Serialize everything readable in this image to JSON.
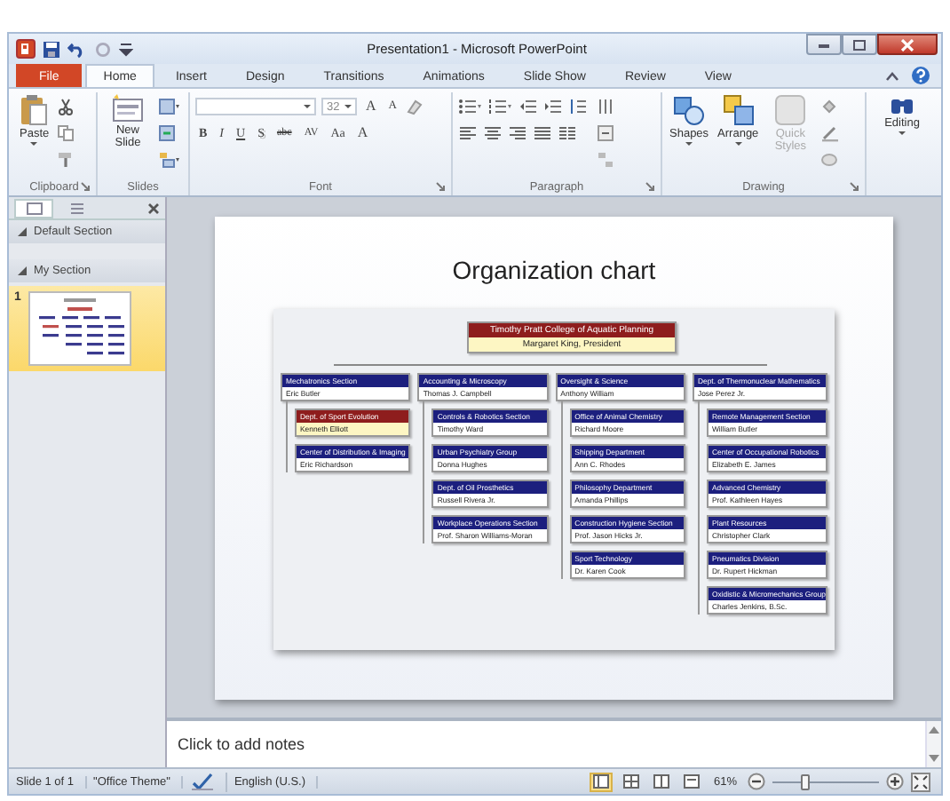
{
  "window": {
    "title": "Presentation1 - Microsoft PowerPoint"
  },
  "tabs": [
    {
      "label": "File",
      "kind": "file",
      "selected": false
    },
    {
      "label": "Home",
      "kind": "tab",
      "selected": true
    },
    {
      "label": "Insert",
      "kind": "tab",
      "selected": false
    },
    {
      "label": "Design",
      "kind": "tab",
      "selected": false
    },
    {
      "label": "Transitions",
      "kind": "tab",
      "selected": false
    },
    {
      "label": "Animations",
      "kind": "tab",
      "selected": false
    },
    {
      "label": "Slide Show",
      "kind": "tab",
      "selected": false
    },
    {
      "label": "Review",
      "kind": "tab",
      "selected": false
    },
    {
      "label": "View",
      "kind": "tab",
      "selected": false
    }
  ],
  "ribbon": {
    "clipboard": {
      "label": "Clipboard",
      "paste": "Paste"
    },
    "slides": {
      "label": "Slides",
      "new_slide": "New Slide"
    },
    "font": {
      "label": "Font",
      "size": "32",
      "grow": "A",
      "shrink": "A",
      "format_buttons": [
        "B",
        "I",
        "U",
        "S",
        "abc",
        "AV",
        "Aa"
      ],
      "color_button": "A"
    },
    "paragraph": {
      "label": "Paragraph"
    },
    "drawing": {
      "label": "Drawing",
      "shapes": "Shapes",
      "arrange": "Arrange",
      "quick_styles": {
        "label": "Quick Styles",
        "disabled": true
      }
    },
    "editing": {
      "label": "Editing"
    }
  },
  "slides_pane": {
    "sections": [
      {
        "label": "Default Section"
      },
      {
        "label": "My Section"
      }
    ],
    "slides": [
      {
        "number": "1",
        "selected": true
      }
    ]
  },
  "slide": {
    "title": "Organization chart",
    "chart": {
      "root": {
        "title": "Timothy Pratt College of Aquatic Planning",
        "name": "Margaret King, President",
        "kind": "accent"
      },
      "columns": [
        {
          "title": "Mechatronics Section",
          "name": "Eric Butler",
          "kind": "standard",
          "children": [
            {
              "title": "Dept. of Sport Evolution",
              "name": "Kenneth Elliott",
              "kind": "accent"
            },
            {
              "title": "Center of Distribution & Imaging",
              "name": "Eric Richardson",
              "kind": "standard"
            }
          ]
        },
        {
          "title": "Accounting & Microscopy",
          "name": "Thomas J. Campbell",
          "kind": "standard",
          "children": [
            {
              "title": "Controls & Robotics Section",
              "name": "Timothy Ward",
              "kind": "standard"
            },
            {
              "title": "Urban Psychiatry Group",
              "name": "Donna Hughes",
              "kind": "standard"
            },
            {
              "title": "Dept. of Oil Prosthetics",
              "name": "Russell Rivera Jr.",
              "kind": "standard"
            },
            {
              "title": "Workplace Operations Section",
              "name": "Prof. Sharon Williams-Moran",
              "kind": "standard"
            }
          ]
        },
        {
          "title": "Oversight & Science",
          "name": "Anthony William",
          "kind": "standard",
          "children": [
            {
              "title": "Office of Animal Chemistry",
              "name": "Richard Moore",
              "kind": "standard"
            },
            {
              "title": "Shipping Department",
              "name": "Ann C. Rhodes",
              "kind": "standard"
            },
            {
              "title": "Philosophy Department",
              "name": "Amanda Phillips",
              "kind": "standard"
            },
            {
              "title": "Construction Hygiene Section",
              "name": "Prof. Jason Hicks Jr.",
              "kind": "standard"
            },
            {
              "title": "Sport Technology",
              "name": "Dr. Karen Cook",
              "kind": "standard"
            }
          ]
        },
        {
          "title": "Dept. of Thermonuclear Mathematics",
          "name": "Jose Perez Jr.",
          "kind": "standard",
          "children": [
            {
              "title": "Remote Management Section",
              "name": "William Butler",
              "kind": "standard"
            },
            {
              "title": "Center of Occupational Robotics",
              "name": "Elizabeth E. James",
              "kind": "standard"
            },
            {
              "title": "Advanced Chemistry",
              "name": "Prof. Kathleen Hayes",
              "kind": "standard"
            },
            {
              "title": "Plant Resources",
              "name": "Christopher Clark",
              "kind": "standard"
            },
            {
              "title": "Pneumatics Division",
              "name": "Dr. Rupert Hickman",
              "kind": "standard"
            },
            {
              "title": "Oxidistic & Micromechanics Group",
              "name": "Charles Jenkins, B.Sc.",
              "kind": "standard"
            }
          ]
        }
      ]
    }
  },
  "notes": {
    "placeholder": "Click to add notes"
  },
  "status_bar": {
    "slide": "Slide 1 of 1",
    "theme": "\"Office Theme\"",
    "language": "English (U.S.)",
    "views": [
      {
        "selected": true
      },
      {
        "selected": false
      },
      {
        "selected": false
      },
      {
        "selected": false
      }
    ],
    "zoom": "61%",
    "zoom_level": {
      "level": 0.3
    }
  }
}
